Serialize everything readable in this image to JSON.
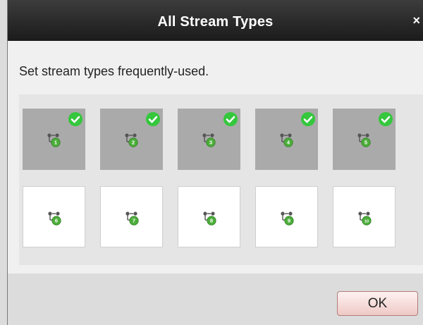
{
  "dialog": {
    "title": "All Stream Types",
    "close_label": "×",
    "description": "Set stream types frequently-used.",
    "ok_label": "OK"
  },
  "stream_types": [
    {
      "number": "1",
      "selected": true
    },
    {
      "number": "2",
      "selected": true
    },
    {
      "number": "3",
      "selected": true
    },
    {
      "number": "4",
      "selected": true
    },
    {
      "number": "5",
      "selected": true
    },
    {
      "number": "6",
      "selected": false
    },
    {
      "number": "7",
      "selected": false
    },
    {
      "number": "8",
      "selected": false
    },
    {
      "number": "9",
      "selected": false
    },
    {
      "number": "10",
      "selected": false
    }
  ],
  "colors": {
    "titlebar": "#1b1b1b",
    "selected_tile": "#aaaaaa",
    "check": "#35c73d",
    "badge": "#4cae3a"
  },
  "icons": {
    "stream": "stream-type-icon",
    "check": "check-icon",
    "close": "close-icon"
  }
}
